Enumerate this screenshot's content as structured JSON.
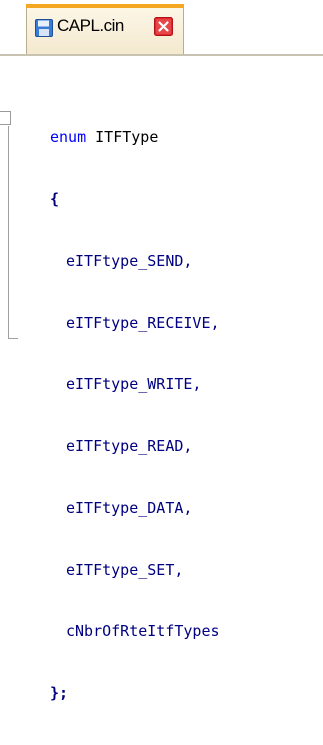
{
  "tab": {
    "file_name": "CAPL.cin",
    "file_icon": "floppy-disk-icon",
    "close_icon": "close-icon"
  },
  "code": {
    "keyword": "enum",
    "type_name": "ITFType",
    "open_brace": "{",
    "members": [
      "eITFtype_SEND,",
      "eITFtype_RECEIVE,",
      "eITFtype_WRITE,",
      "eITFtype_READ,",
      "eITFtype_DATA,",
      "eITFtype_SET,",
      "cNbrOfRteItfTypes"
    ],
    "close_brace": "};"
  },
  "colors": {
    "keyword": "#0000ff",
    "identifier": "#000080",
    "tab_accent": "#f5a623",
    "close_red": "#e2262a"
  }
}
